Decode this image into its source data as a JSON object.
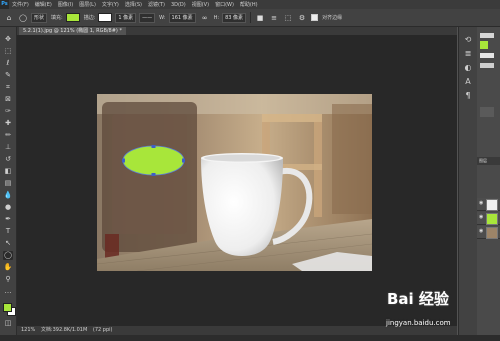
{
  "app": {
    "logo_text": "Ps",
    "menu": [
      "文件(F)",
      "编辑(E)",
      "图像(I)",
      "图层(L)",
      "文字(Y)",
      "选择(S)",
      "滤镜(T)",
      "3D(D)",
      "视图(V)",
      "窗口(W)",
      "帮助(H)"
    ]
  },
  "options": {
    "mode_label": "形状",
    "fill_label": "填充:",
    "fill_color": "#a8e63a",
    "stroke_label": "描边:",
    "stroke_width": "1 像素",
    "w_label": "W:",
    "w_value": "161 像素",
    "h_label": "H:",
    "h_value": "83 像素",
    "align_edges_label": "对齐边缘"
  },
  "document": {
    "tab_title": "5.2.1(1).jpg @ 121% (椭圆 1, RGB/8#) *",
    "zoom": "121%",
    "doc_info": "文档:392.8K/1.01M",
    "status_extra": "(72 ppi)"
  },
  "canvas": {
    "background": "#282828",
    "shape_color": "#a8e63a"
  },
  "colors": {
    "foreground": "#a8e63a",
    "background": "#ffffff"
  },
  "layers_panel": {
    "tab_label": "图层"
  },
  "watermark": {
    "brand": "Bai 经验",
    "url": "jingyan.baidu.com"
  }
}
